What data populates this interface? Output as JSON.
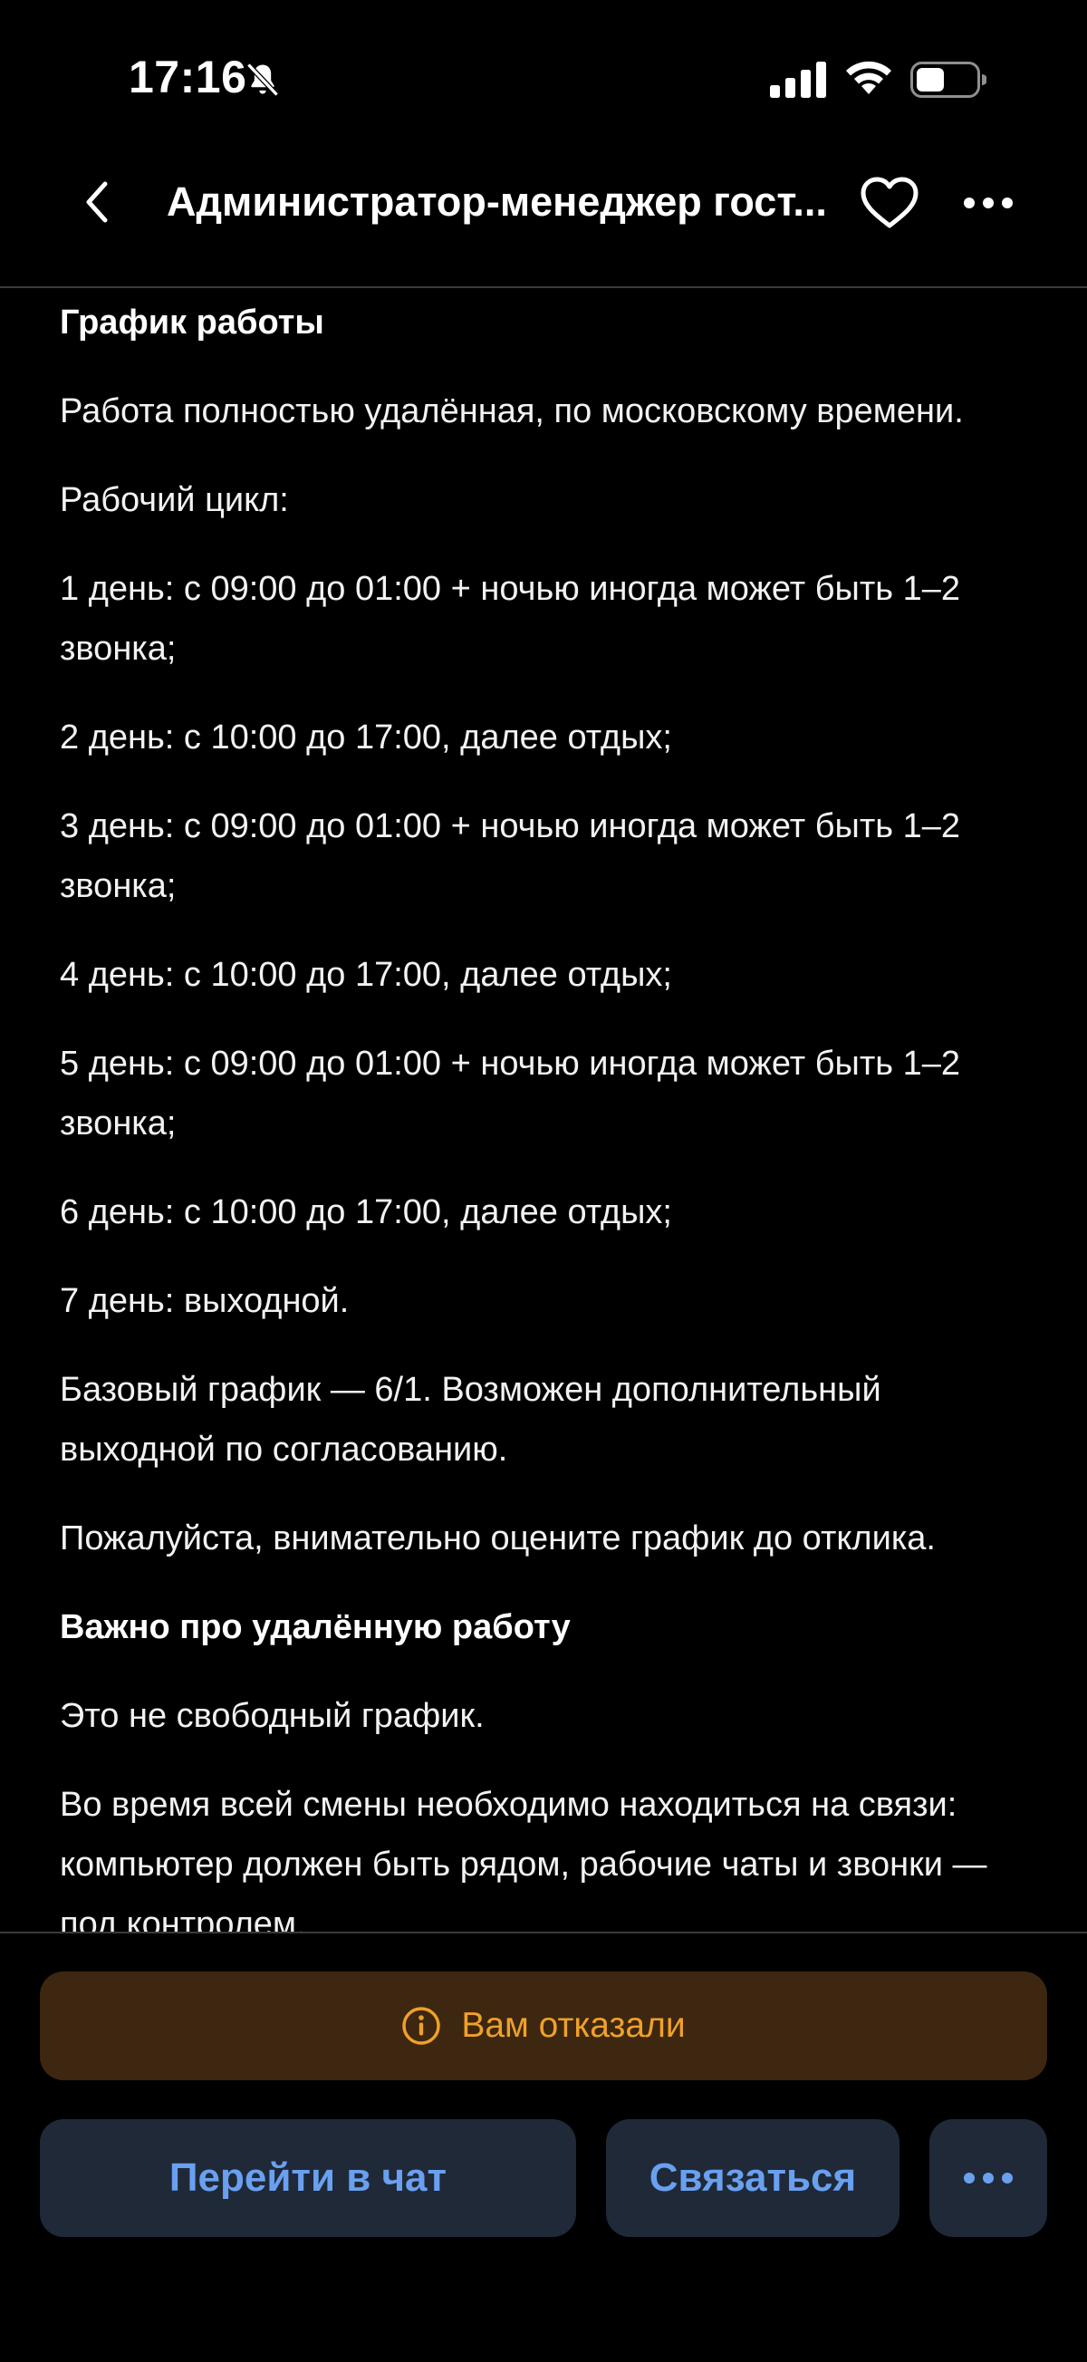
{
  "status_bar": {
    "time": "17:16"
  },
  "nav": {
    "title": "Администратор-менеджер гост..."
  },
  "content": {
    "heading_schedule": "График работы",
    "p_remote": "Работа полностью удалённая, по московскому времени.",
    "p_cycle": "Рабочий цикл:",
    "day1": "1 день: с 09:00 до 01:00 + ночью иногда может быть 1–2 звонка;",
    "day2": "2 день: с 10:00 до 17:00, далее отдых;",
    "day3": "3 день: с 09:00 до 01:00 + ночью иногда может быть 1–2 звонка;",
    "day4": "4 день: с 10:00 до 17:00, далее отдых;",
    "day5": "5 день: с 09:00 до 01:00 + ночью иногда может быть 1–2 звонка;",
    "day6": "6 день: с 10:00 до 17:00, далее отдых;",
    "day7": "7 день: выходной.",
    "p_base": "Базовый график — 6/1. Возможен дополнительный выходной по согласованию.",
    "p_please": "Пожалуйста, внимательно оцените график до отклика.",
    "heading_remote": "Важно про удалённую работу",
    "p_not_free": "Это не свободный график.",
    "p_online": "Во время всей смены необходимо находиться на связи: компьютер должен быть рядом, рабочие чаты и звонки — под контролем."
  },
  "bottom": {
    "status_label": "Вам отказали",
    "chat_button": "Перейти в чат",
    "contact_button": "Связаться"
  },
  "colors": {
    "accent_blue": "#6aa0f0",
    "warning_orange": "#f0a02a",
    "warning_bg": "#3d2710",
    "button_bg": "#1f2938"
  }
}
